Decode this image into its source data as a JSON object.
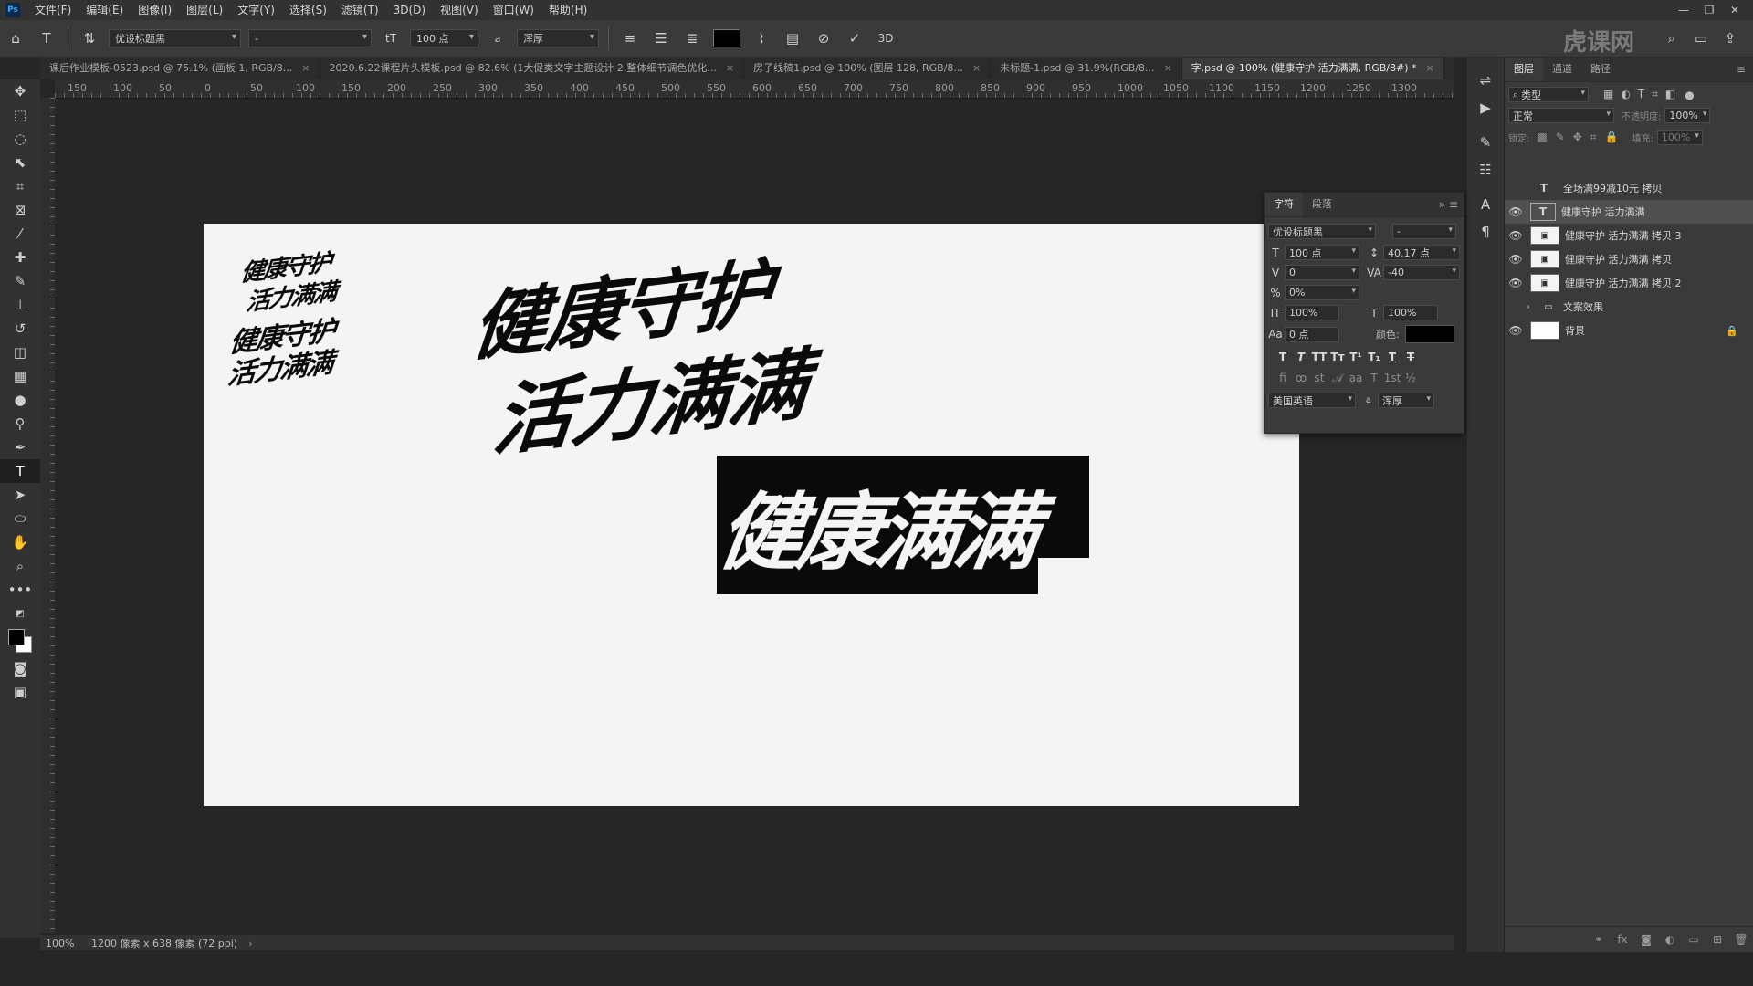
{
  "app": {
    "logo": "Ps",
    "menu": [
      "文件(F)",
      "编辑(E)",
      "图像(I)",
      "图层(L)",
      "文字(Y)",
      "选择(S)",
      "滤镜(T)",
      "3D(D)",
      "视图(V)",
      "窗口(W)",
      "帮助(H)"
    ],
    "watermark": "虎课网"
  },
  "options": {
    "font_family": "优设标题黑",
    "font_style": "-",
    "font_size": "100 点",
    "aa_label": "a",
    "antialias": "浑厚",
    "text_color": "#000000",
    "three_d": "3D"
  },
  "tabs": [
    {
      "label": "课后作业模板-0523.psd @ 75.1% (画板 1, RGB/8..."
    },
    {
      "label": "2020.6.22课程片头模板.psd @ 82.6% (1大促类文字主题设计 2.整体细节调色优化..."
    },
    {
      "label": "房子线稿1.psd @ 100% (图层 128, RGB/8..."
    },
    {
      "label": "未标题-1.psd @ 31.9%(RGB/8..."
    },
    {
      "label": "字.psd @ 100% (健康守护 活力满满, RGB/8#) *",
      "active": true
    }
  ],
  "ruler_top": [
    "150",
    "100",
    "50",
    "0",
    "50",
    "100",
    "150",
    "200",
    "250",
    "300",
    "350",
    "400",
    "450",
    "500",
    "550",
    "600",
    "650",
    "700",
    "750",
    "800",
    "850",
    "900",
    "950",
    "1000",
    "1050",
    "1100",
    "1150",
    "1200",
    "1250",
    "1300"
  ],
  "canvas": {
    "line1": "健康守护",
    "line2": "活力满满",
    "block_text": "健康满满"
  },
  "status": {
    "zoom": "100%",
    "doc_size": "1200 像素 x 638 像素 (72 ppi)"
  },
  "character_panel": {
    "tab_char": "字符",
    "tab_para": "段落",
    "font_family": "优设标题黑",
    "font_style": "-",
    "size": "100 点",
    "leading": "40.17 点",
    "kerning": "0",
    "tracking": "-40",
    "scale_pct": "0%",
    "vscale": "100%",
    "hscale": "100%",
    "baseline": "0 点",
    "color_label": "颜色:",
    "color": "#000000",
    "language": "美国英语",
    "aa_label": "a",
    "antialias": "浑厚"
  },
  "layers_panel": {
    "tabs": [
      "图层",
      "通道",
      "路径"
    ],
    "filter": "类型",
    "blend": "正常",
    "opacity_label": "不透明度:",
    "opacity": "100%",
    "lock_label": "锁定:",
    "fill_label": "填充:",
    "fill": "100%",
    "layers": [
      {
        "name": "全场满99减10元 拷贝",
        "kind": "text",
        "visible": false
      },
      {
        "name": "健康守护 活力满满",
        "kind": "text",
        "visible": true,
        "selected": true
      },
      {
        "name": "健康守护 活力满满 拷贝 3",
        "kind": "smart",
        "visible": true
      },
      {
        "name": "健康守护 活力满满 拷贝",
        "kind": "smart",
        "visible": true
      },
      {
        "name": "健康守护 活力满满 拷贝 2",
        "kind": "smart",
        "visible": true
      },
      {
        "name": "文案效果",
        "kind": "group",
        "visible": false
      },
      {
        "name": "背景",
        "kind": "fill",
        "visible": true,
        "locked": true
      }
    ]
  }
}
